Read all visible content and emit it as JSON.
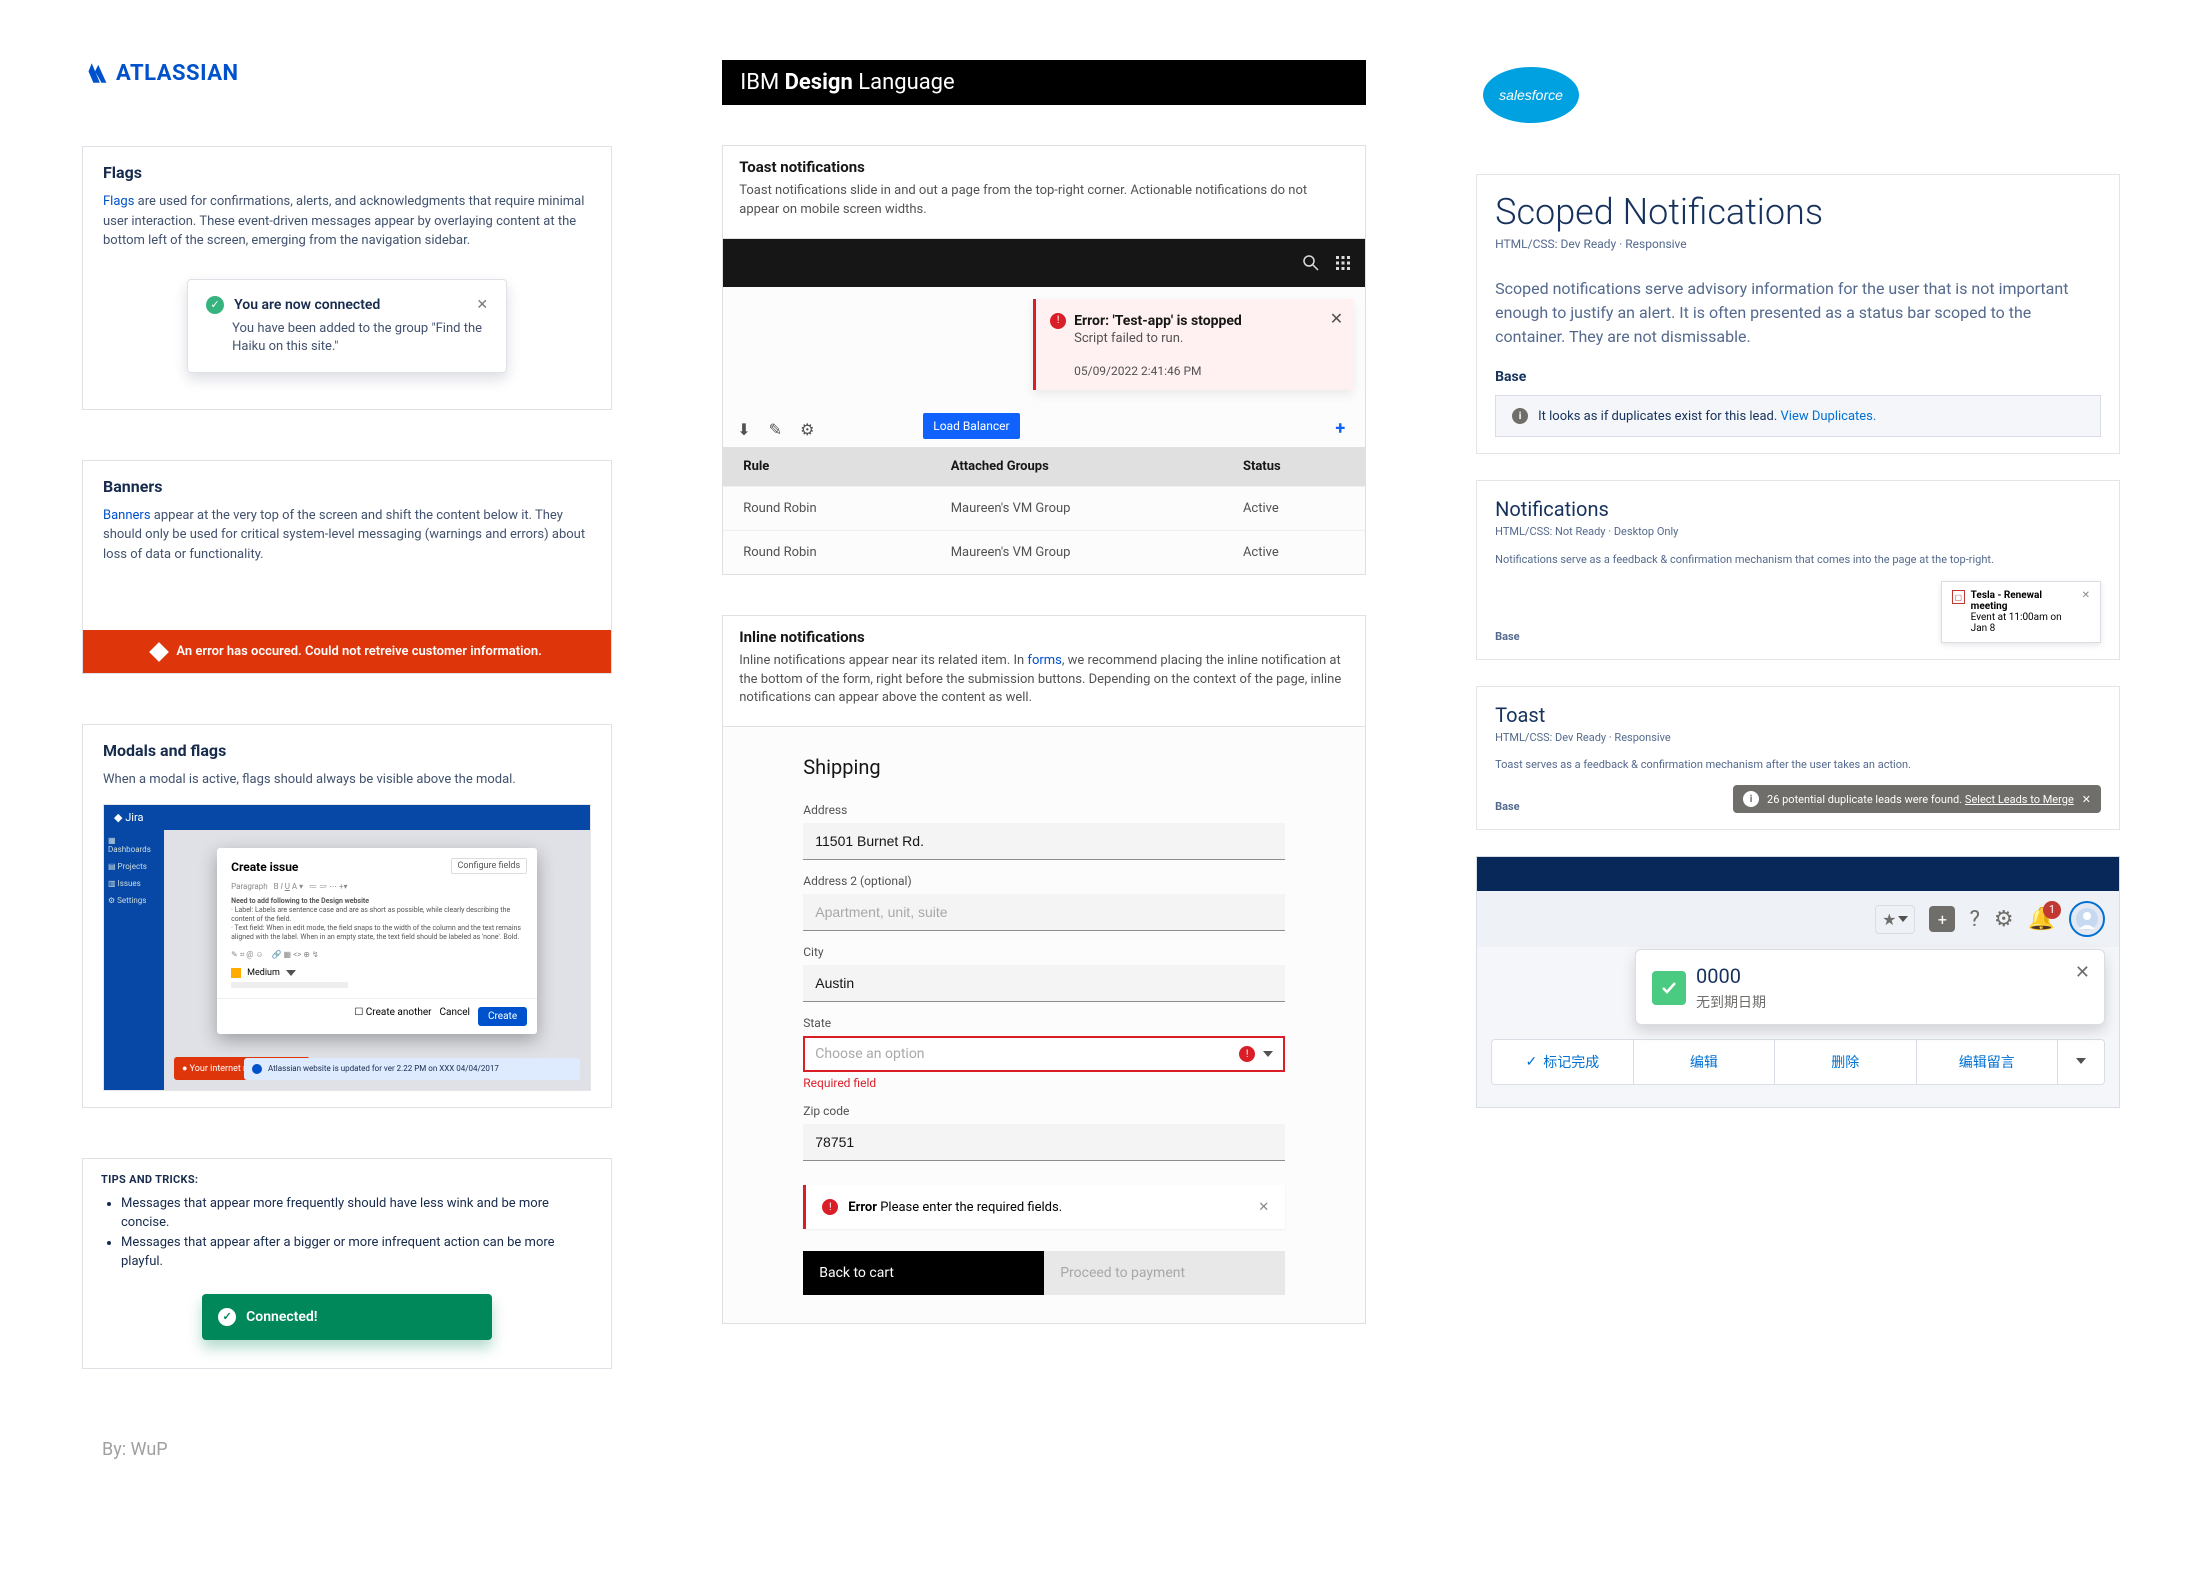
{
  "atlassian": {
    "brand": "ATLASSIAN",
    "flags": {
      "heading": "Flags",
      "linkword": "Flags",
      "desc_rest": " are used for confirmations, alerts, and acknowledgments that require minimal user interaction. These event-driven messages appear by overlaying content at the bottom left of the screen, emerging from the navigation sidebar.",
      "flag_title": "You are now connected",
      "flag_body": "You have been added to the group \"Find the Haiku on this site.\""
    },
    "banners": {
      "heading": "Banners",
      "linkword": "Banners",
      "desc_rest": " appear at the very top of the screen and shift the content below it. They should only be used for critical system-level messaging (warnings and errors) about loss of data or functionality.",
      "banner_text": "An error has occured. Could not retreive customer information."
    },
    "modals": {
      "heading": "Modals and flags",
      "desc": "When a modal is active, flags should always be visible above the modal.",
      "jira_label": "Jira",
      "create_issue": "Create issue",
      "configure_fields": "Configure fields",
      "guide_title": "Need to add following to the Design website",
      "guide_1": "· Label: Labels are sentence case and are as short as possible, while clearly describing the content of the field.",
      "guide_2": "· Text field: When in edit mode, the field snaps to the width of the column and the text remains aligned with the label. When in an empty state, the text field should be labeled as 'none'. Bold.",
      "priority": "Medium",
      "cancel": "Cancel",
      "create_another": "Create another",
      "create": "Create",
      "red_flag": "Your internet may be off",
      "info_flag": "Atlassian website is updated for ver 2.22 PM on XXX 04/04/2017"
    },
    "tips": {
      "heading": "TIPS AND TRICKS:",
      "t1": "Messages that appear more frequently should have less wink and be more concise.",
      "t2": "Messages that appear after a bigger or more infrequent action can be more playful.",
      "connected": "Connected!"
    }
  },
  "ibm": {
    "brand_pre": "IBM ",
    "brand_bold": "Design",
    "brand_post": " Language",
    "toast": {
      "heading": "Toast notifications",
      "desc": "Toast notifications slide in and out a page from the top-right corner. Actionable notifications do not appear on mobile screen widths.",
      "title": "Error: 'Test-app' is stopped",
      "body": "Script failed to run.",
      "time": "05/09/2022 2:41:46 PM",
      "pill": "Load Balancer",
      "table": {
        "cols": [
          "Rule",
          "Attached Groups",
          "Status"
        ],
        "rows": [
          [
            "Round Robin",
            "Maureen's VM Group",
            "Active"
          ],
          [
            "Round Robin",
            "Maureen's VM Group",
            "Active"
          ]
        ]
      }
    },
    "inline": {
      "heading": "Inline notifications",
      "desc_pre": "Inline notifications appear near its related item. In ",
      "forms_link": "forms",
      "desc_post": ", we recommend placing the inline notification at the bottom of the form, right before the submission buttons. Depending on the context of the page, inline notifications can appear above the content as well.",
      "form": {
        "title": "Shipping",
        "l_address": "Address",
        "v_address": "11501 Burnet Rd.",
        "l_address2": "Address 2 (optional)",
        "p_address2": "Apartment, unit, suite",
        "l_city": "City",
        "v_city": "Austin",
        "l_state": "State",
        "p_state": "Choose an option",
        "required": "Required field",
        "l_zip": "Zip code",
        "v_zip": "78751",
        "err_title": "Error",
        "err_body": " Please enter the required fields.",
        "back": "Back to cart",
        "proceed": "Proceed to payment"
      }
    }
  },
  "salesforce": {
    "scoped": {
      "heading": "Scoped Notifications",
      "sub": "HTML/CSS: Dev Ready  ·  Responsive",
      "desc": "Scoped notifications serve advisory information for the user that is not important enough to justify an alert. It is often presented as a status bar scoped to the container. They are not dismissable.",
      "base_label": "Base",
      "msg": "It looks as if duplicates exist for this lead. ",
      "view": "View Duplicates."
    },
    "notifications": {
      "heading": "Notifications",
      "sub": "HTML/CSS: Not Ready  ·  Desktop Only",
      "desc": "Notifications serve as a feedback & confirmation mechanism that comes into the page at the top-right.",
      "base_label": "Base",
      "tile_title": "Tesla - Renewal meeting",
      "tile_sub": "Event at 11:00am on Jan 8"
    },
    "toast": {
      "heading": "Toast",
      "sub": "HTML/CSS: Dev Ready  ·  Responsive",
      "desc": "Toast serves as a feedback & confirmation mechanism after the user takes an action.",
      "base_label": "Base",
      "msg": "26 potential duplicate leads were found. ",
      "link": "Select Leads to Merge"
    },
    "task": {
      "title": "0000",
      "sub": "无到期日期",
      "a1": "标记完成",
      "a2": "编辑",
      "a3": "删除",
      "a4": "编辑留言",
      "badge": "1"
    }
  },
  "byline": "By: WuP"
}
